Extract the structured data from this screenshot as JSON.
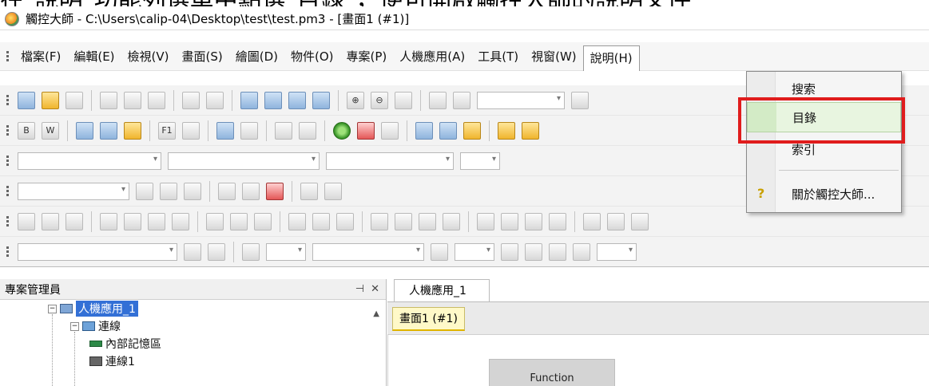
{
  "caption": "在\"說明\"功能列選單中點選\"目錄\"，便可開啟觸控大師的說明文件",
  "window": {
    "title": "觸控大師 - C:\\Users\\calip-04\\Desktop\\test\\test.pm3 - [畫面1 (#1)]"
  },
  "menu": {
    "items": [
      {
        "label": "檔案(F)"
      },
      {
        "label": "編輯(E)"
      },
      {
        "label": "檢視(V)"
      },
      {
        "label": "畫面(S)"
      },
      {
        "label": "繪圖(D)"
      },
      {
        "label": "物件(O)"
      },
      {
        "label": "專案(P)"
      },
      {
        "label": "人機應用(A)"
      },
      {
        "label": "工具(T)"
      },
      {
        "label": "視窗(W)"
      },
      {
        "label": "說明(H)"
      }
    ],
    "active_index": 10
  },
  "help_menu": {
    "items": [
      {
        "label": "搜索",
        "icon": "none"
      },
      {
        "label": "目錄",
        "icon": "none",
        "highlighted": true
      },
      {
        "label": "索引",
        "icon": "none"
      },
      {
        "label": "關於觸控大師...",
        "icon": "question-mark-icon"
      }
    ],
    "highlight_color": "#e01c1c"
  },
  "toolbar": {
    "zoom_in_glyph": "⊕",
    "zoom_out_glyph": "⊖",
    "btn_b": "B",
    "btn_w": "W",
    "btn_f1": "F1"
  },
  "project_panel": {
    "title": "專案管理員",
    "pin_glyph": "⊣",
    "close_glyph": "✕",
    "tree": [
      {
        "label": "人機應用_1",
        "toggle": "−",
        "selected": true
      },
      {
        "label": "連線",
        "toggle": "−"
      },
      {
        "label": "內部記憶區"
      },
      {
        "label": "連線1"
      }
    ]
  },
  "workspace": {
    "tab_label": "人機應用_1",
    "screen_tab_label": "畫面1 (#1)",
    "canvas_object_text": "Function"
  }
}
